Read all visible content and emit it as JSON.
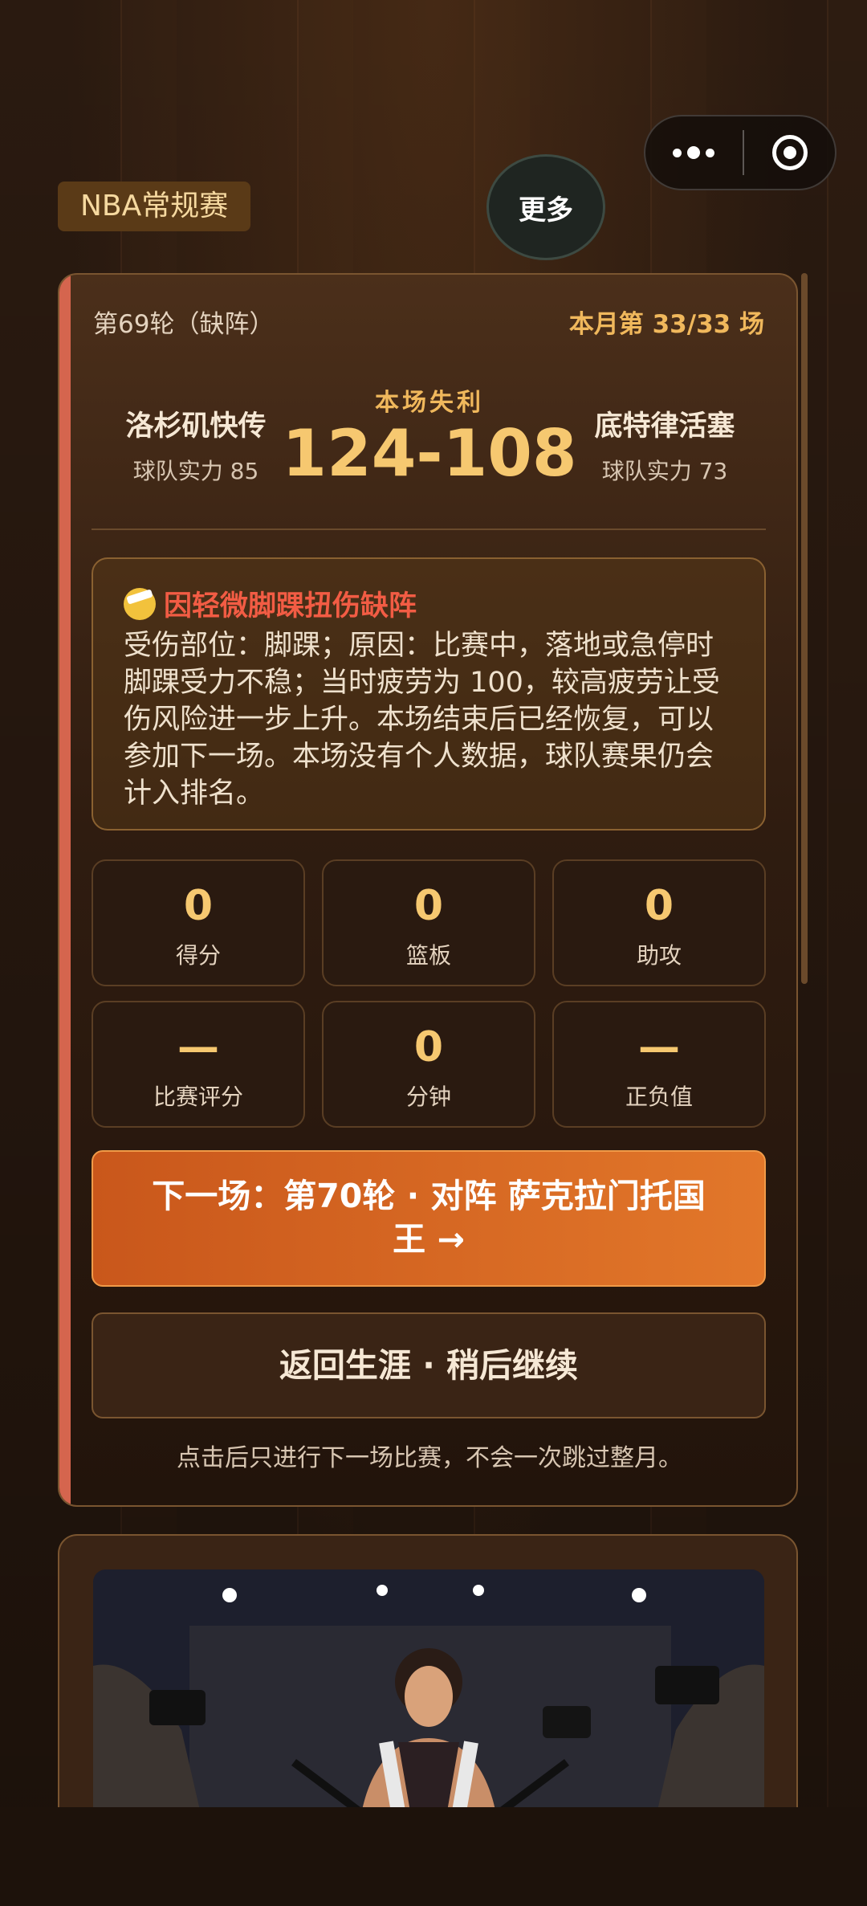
{
  "league_tag": "NBA常规赛",
  "more_label": "更多",
  "match": {
    "round_label": "第69轮（缺阵）",
    "month_progress": "本月第 33/33 场",
    "result_label": "本场失利",
    "score": "124-108",
    "home": {
      "name": "洛杉矶快传",
      "power": "球队实力 85"
    },
    "away": {
      "name": "底特律活塞",
      "power": "球队实力 73"
    }
  },
  "injury": {
    "icon": "bandaged-face-emoji",
    "title": "因轻微脚踝扭伤缺阵",
    "body": "受伤部位：脚踝；原因：比赛中，落地或急停时脚踝受力不稳；当时疲劳为 100，较高疲劳让受伤风险进一步上升。本场结束后已经恢复，可以参加下一场。本场没有个人数据，球队赛果仍会计入排名。"
  },
  "stats": [
    {
      "value": "0",
      "label": "得分"
    },
    {
      "value": "0",
      "label": "篮板"
    },
    {
      "value": "0",
      "label": "助攻"
    },
    {
      "value": "—",
      "label": "比赛评分"
    },
    {
      "value": "0",
      "label": "分钟"
    },
    {
      "value": "—",
      "label": "正负值"
    }
  ],
  "next_button": "下一场：第70轮 · 对阵 萨克拉门托国王 →",
  "back_button": "返回生涯 · 稍后继续",
  "note": "点击后只进行下一场比赛，不会一次跳过整月。",
  "colors": {
    "accent": "#d5654e",
    "gold": "#f6c870",
    "orange": "#e2772a",
    "injury": "#f25c44"
  }
}
